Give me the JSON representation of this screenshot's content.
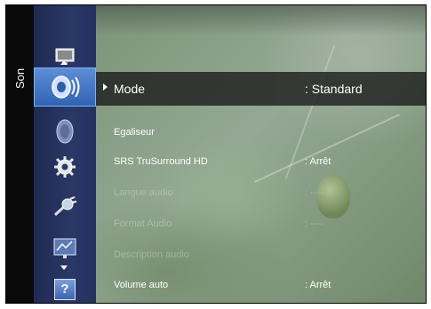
{
  "sidebar": {
    "vertical_label": "Son",
    "icons": [
      {
        "name": "picture-icon"
      },
      {
        "name": "sound-icon",
        "selected": true
      },
      {
        "name": "channel-icon"
      },
      {
        "name": "setup-icon"
      },
      {
        "name": "input-icon"
      },
      {
        "name": "application-icon"
      },
      {
        "name": "support-icon",
        "glyph": "?"
      }
    ]
  },
  "menu": {
    "header": {
      "label": "Mode",
      "value": ": Standard"
    },
    "items": [
      {
        "label": "Egaliseur",
        "value": "",
        "enabled": true
      },
      {
        "label": "SRS TruSurround HD",
        "value": ": Arrêt",
        "enabled": true
      },
      {
        "label": "Langue audio",
        "value": ": ----",
        "enabled": false
      },
      {
        "label": "Format Audio",
        "value": ": ----",
        "enabled": false
      },
      {
        "label": "Description audio",
        "value": "",
        "enabled": false
      },
      {
        "label": "Volume auto",
        "value": ": Arrêt",
        "enabled": true
      }
    ]
  }
}
